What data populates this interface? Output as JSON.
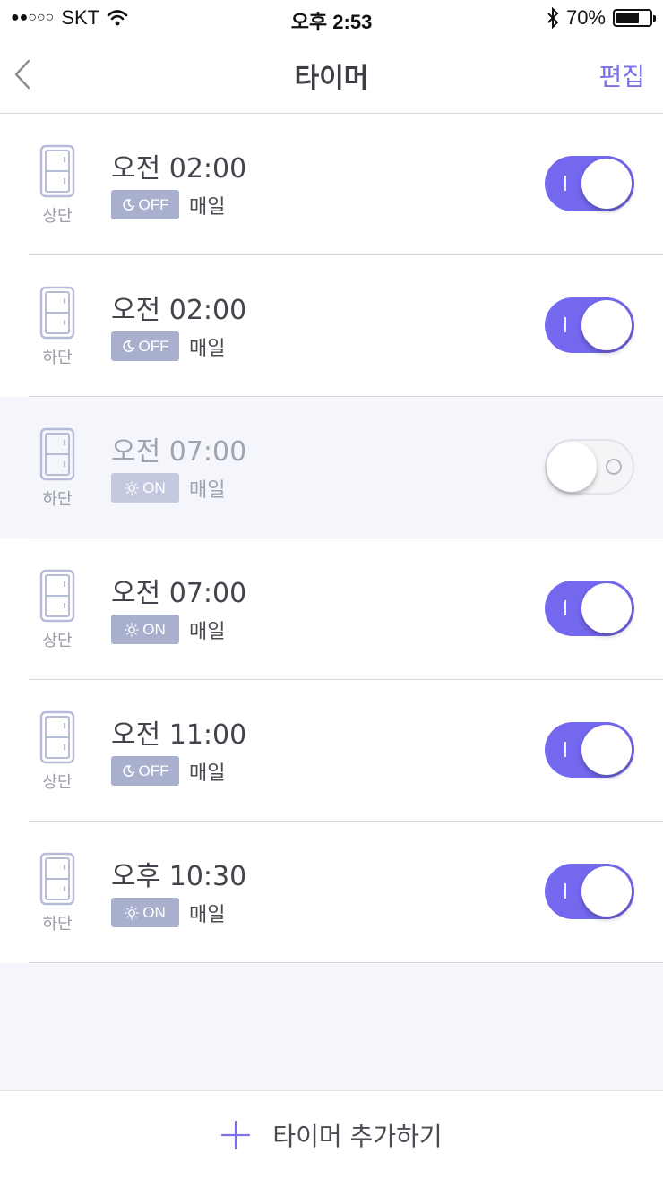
{
  "status_bar": {
    "signal": "●●○○○",
    "carrier": "SKT",
    "time": "오후 2:53",
    "battery_text": "70%",
    "battery_level": 0.7
  },
  "nav": {
    "title": "타이머",
    "edit_label": "편집",
    "back_icon": "chevron-left-icon"
  },
  "timers": [
    {
      "position": "상단",
      "time": "오전 02:00",
      "mode": "OFF",
      "mode_icon": "moon-icon",
      "repeat": "매일",
      "enabled": true
    },
    {
      "position": "하단",
      "time": "오전 02:00",
      "mode": "OFF",
      "mode_icon": "moon-icon",
      "repeat": "매일",
      "enabled": true
    },
    {
      "position": "하단",
      "time": "오전 07:00",
      "mode": "ON",
      "mode_icon": "sun-icon",
      "repeat": "매일",
      "enabled": false
    },
    {
      "position": "상단",
      "time": "오전 07:00",
      "mode": "ON",
      "mode_icon": "sun-icon",
      "repeat": "매일",
      "enabled": true
    },
    {
      "position": "상단",
      "time": "오전 11:00",
      "mode": "OFF",
      "mode_icon": "moon-icon",
      "repeat": "매일",
      "enabled": true
    },
    {
      "position": "하단",
      "time": "오후 10:30",
      "mode": "ON",
      "mode_icon": "sun-icon",
      "repeat": "매일",
      "enabled": true
    }
  ],
  "footer": {
    "add_label": "타이머 추가하기",
    "add_icon": "plus-icon"
  },
  "colors": {
    "accent": "#7468ee",
    "badge": "#a9b0ce",
    "background": "#f4f6fb"
  }
}
